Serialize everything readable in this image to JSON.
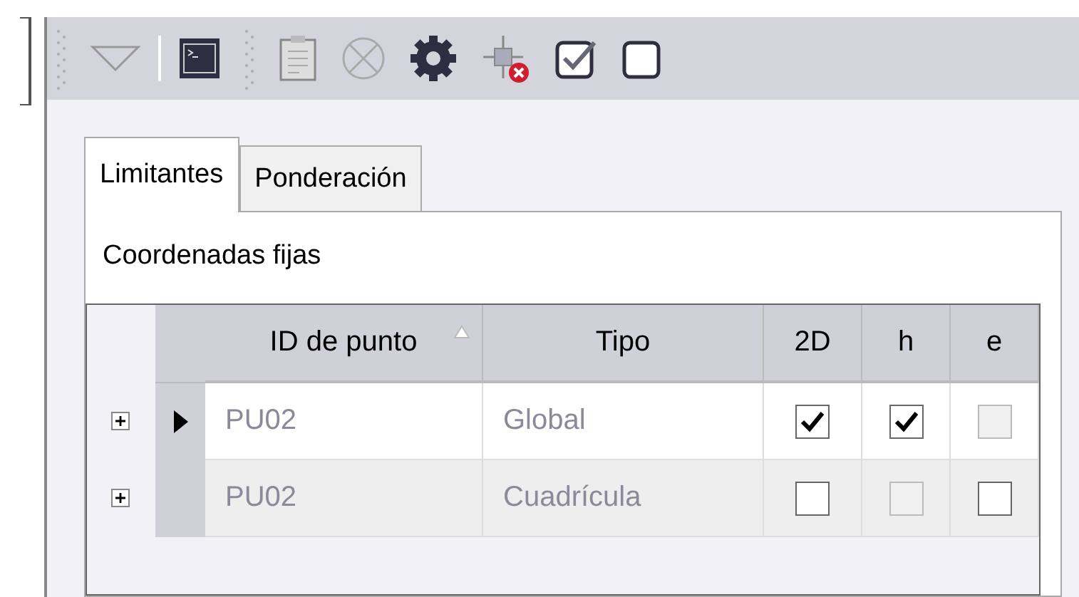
{
  "tabs": [
    {
      "label": "Limitantes",
      "selected": true
    },
    {
      "label": "Ponderación",
      "selected": false
    }
  ],
  "section_title": "Coordenadas fijas",
  "table": {
    "columns": [
      {
        "label": "ID de punto",
        "sorted": true
      },
      {
        "label": "Tipo",
        "sorted": false
      },
      {
        "label": "2D",
        "sorted": false
      },
      {
        "label": "h",
        "sorted": false
      },
      {
        "label": "e",
        "sorted": false
      }
    ],
    "rows": [
      {
        "selected": true,
        "expanded": false,
        "id": "PU02",
        "tipo": "Global",
        "checks": [
          {
            "checked": true,
            "disabled": false
          },
          {
            "checked": true,
            "disabled": false
          },
          {
            "checked": false,
            "disabled": true
          }
        ]
      },
      {
        "selected": false,
        "expanded": false,
        "id": "PU02",
        "tipo": "Cuadrícula",
        "checks": [
          {
            "checked": false,
            "disabled": false
          },
          {
            "checked": false,
            "disabled": true
          },
          {
            "checked": false,
            "disabled": false
          }
        ]
      }
    ]
  }
}
